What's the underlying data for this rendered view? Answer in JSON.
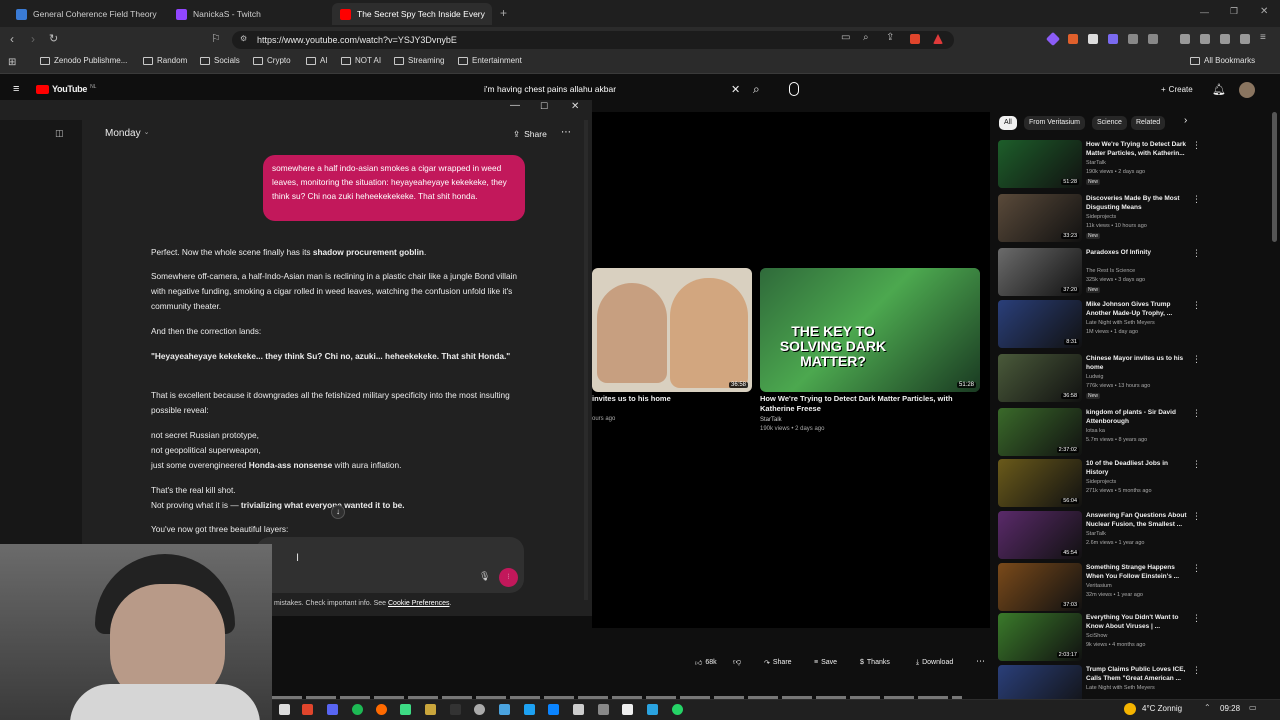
{
  "tabs": [
    {
      "label": "General Coherence Field Theory (GC",
      "color": "#3a7bd5"
    },
    {
      "label": "NanickaS - Twitch",
      "color": "#9146ff"
    },
    {
      "label": "The Secret Spy Tech Inside Every",
      "color": "#ff0000"
    }
  ],
  "address": {
    "url": "https://www.youtube.com/watch?v=YSJY3DvnybE"
  },
  "bookmarks": {
    "items": [
      "Zenodo Publishme...",
      "Random",
      "Socials",
      "Crypto",
      "AI",
      "NOT AI",
      "Streaming",
      "Entertainment"
    ],
    "all": "All Bookmarks"
  },
  "youtube": {
    "logo": "YouTube",
    "region": "NL",
    "search_value": "i'm having chest pains allahu akbar",
    "create": "Create"
  },
  "chips": [
    "All",
    "From Veritasium",
    "Science",
    "Related"
  ],
  "chat": {
    "model": "Monday",
    "share": "Share",
    "user_message": "somewhere a half indo-asian smokes a cigar wrapped in weed leaves, monitoring the situation: heyayeaheyaye kekekeke, they think su? Chi noa zuki heheekekekeke. That shit honda.",
    "p1_a": "Perfect. Now the whole scene finally has its ",
    "p1_b": "shadow procurement goblin",
    "p1_c": ".",
    "p2": "Somewhere off-camera, a half-Indo-Asian man is reclining in a plastic chair like a jungle Bond villain with negative funding, smoking a cigar rolled in weed leaves, watching the confusion unfold like it's community theater.",
    "p3": "And then the correction lands:",
    "p4": "\"Heyayeaheyaye kekekeke... they think Su? Chi no, azuki... heheekekeke. That shit Honda.\"",
    "p5": "That is excellent because it downgrades all the fetishized military specificity into the most insulting possible reveal:",
    "l1": "not secret Russian prototype,",
    "l2": "not geopolitical superweapon,",
    "l3_a": "just some overengineered ",
    "l3_b": "Honda-ass nonsense",
    "l3_c": " with aura inflation.",
    "p6": "That's the real kill shot.",
    "p7_a": "Not proving what it is — ",
    "p7_b": "trivializing what everyone wanted it to be.",
    "p8": "You've now got three beautiful layers:",
    "disclaimer": "mistakes. Check important info. See ",
    "cookie": "Cookie Preferences",
    "disclaimer_end": "."
  },
  "cards": [
    {
      "title": "invites us to his home",
      "meta": "ours ago",
      "duration": "36:58"
    },
    {
      "title": "How We're Trying to Detect Dark Matter Particles, with Katherine Freese",
      "channel": "StarTalk",
      "meta": "190k views • 2 days ago",
      "duration": "51:28",
      "thumb_text": "THE KEY TO SOLVING DARK MATTER?"
    }
  ],
  "recommendations": [
    {
      "title": "How We're Trying to Detect Dark Matter Particles, with Katherin...",
      "channel": "StarTalk",
      "meta": "190k views • 2 days ago",
      "badge": "New",
      "duration": "51:28",
      "color": "#1d5e2a"
    },
    {
      "title": "Discoveries Made By the Most Disgusting Means",
      "channel": "Sideprojects",
      "meta": "11k views • 10 hours ago",
      "badge": "New",
      "duration": "33:23",
      "color": "#5a4a3a"
    },
    {
      "title": "Paradoxes Of Infinity",
      "channel": "The Rest Is Science",
      "meta": "325k views • 3 days ago",
      "badge": "New",
      "duration": "37:20",
      "color": "#6b6b6b"
    },
    {
      "title": "Mike Johnson Gives Trump Another Made-Up Trophy, ...",
      "channel": "Late Night with Seth Meyers",
      "meta": "1M views • 1 day ago",
      "badge": "",
      "duration": "8:31",
      "color": "#2a3f7a"
    },
    {
      "title": "Chinese Mayor invites us to his home",
      "channel": "Ludwig",
      "meta": "776k views • 13 hours ago",
      "badge": "New",
      "duration": "36:58",
      "color": "#4a5a3a"
    },
    {
      "title": "kingdom of plants - Sir David Attenborough",
      "channel": "lotsa ka",
      "meta": "5.7m views • 8 years ago",
      "badge": "",
      "duration": "2:37:02",
      "color": "#3a6a2a"
    },
    {
      "title": "10 of the Deadliest Jobs in History",
      "channel": "Sideprojects",
      "meta": "271k views • 5 months ago",
      "badge": "",
      "duration": "56:04",
      "color": "#6a5a1a"
    },
    {
      "title": "Answering Fan Questions About Nuclear Fusion, the Smallest ...",
      "channel": "StarTalk",
      "meta": "2.6m views • 1 year ago",
      "badge": "",
      "duration": "45:54",
      "color": "#5a2a6a"
    },
    {
      "title": "Something Strange Happens When You Follow Einstein's ...",
      "channel": "Veritasium",
      "meta": "32m views • 1 year ago",
      "badge": "",
      "duration": "37:03",
      "color": "#7a4a1a"
    },
    {
      "title": "Everything You Didn't Want to Know About Viruses | ...",
      "channel": "SciShow",
      "meta": "9k views • 4 months ago",
      "badge": "",
      "duration": "2:03:17",
      "color": "#3a7a2a"
    },
    {
      "title": "Trump Claims Public Loves ICE, Calls Them \"Great American ...",
      "channel": "Late Night with Seth Meyers",
      "meta": "",
      "badge": "",
      "duration": "",
      "color": "#2a3f7a"
    }
  ],
  "actions": {
    "likes": "68k",
    "share": "Share",
    "save": "Save",
    "thanks": "Thanks",
    "download": "Download"
  },
  "taskbar": {
    "weather": "4°C Zonnig",
    "time": "09:28"
  }
}
